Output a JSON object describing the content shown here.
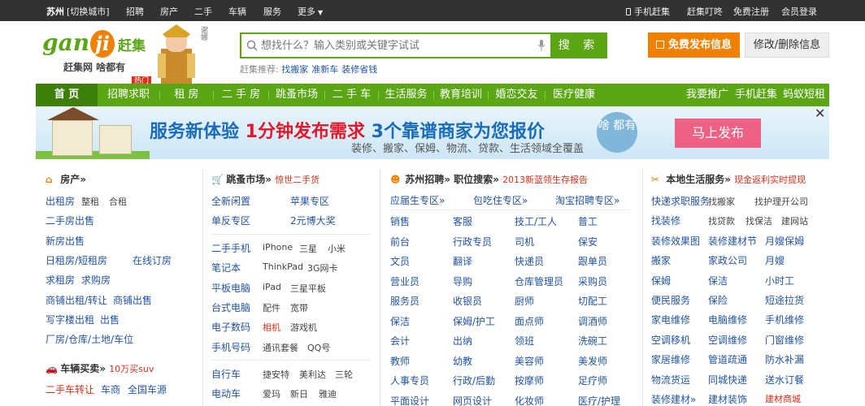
{
  "top": {
    "city": "苏州",
    "switch": "[切换城市]",
    "nav": [
      "招聘",
      "房产",
      "二手",
      "车辆",
      "服务",
      "更多"
    ],
    "mobile": "手机赶集",
    "ganji_ding": "赶集叮咚",
    "register": "免费注册",
    "login": "会员登录"
  },
  "logo": {
    "brand_left": "gan",
    "brand_mid": "ji",
    "brand_right": "赶集",
    "slogan": "赶集网 啥都有",
    "hot": "热门",
    "star": "谢娜"
  },
  "search": {
    "placeholder": "想找什么？输入类别或关键字试试",
    "button": "搜 索",
    "hot_label": "赶集推荐:",
    "hot": [
      "找搬家",
      "准新车",
      "装修省钱"
    ]
  },
  "buttons": {
    "post": "免费发布信息",
    "edit": "修改/删除信息"
  },
  "nav": {
    "items": [
      "首 页",
      "招聘求职",
      "租 房",
      "二 手 房",
      "跳蚤市场",
      "二 手 车",
      "生活服务",
      "教育培训",
      "婚恋交友",
      "医疗健康"
    ],
    "right": [
      "我要推广",
      "手机赶集",
      "蚂蚁短租"
    ]
  },
  "banner": {
    "headline_a": "服务新体验 ",
    "headline_b": "1分钟发布需求",
    "headline_c": " 3个靠谱商家为您报价",
    "sub": "装修、搬家、保姆、物流、贷款、生活领域全覆盖",
    "bubble": "啥 都有",
    "go": "马上发布",
    "close": "✕"
  },
  "col1": {
    "title": "房产»",
    "rows": [
      [
        "出租房",
        "整租",
        "合租"
      ],
      [
        "二手房出售"
      ],
      [
        "新房出售"
      ],
      [
        "日租房/短租房",
        "在线订房"
      ],
      [
        "求租房",
        "求购房"
      ],
      [
        "商铺出租/转让",
        "商铺出售"
      ],
      [
        "写字楼出租",
        "出售"
      ],
      [
        "厂房/仓库/土地/车位"
      ]
    ],
    "title2": "车辆买卖»",
    "sub2": "10万买suv",
    "rows2": [
      [
        "二手车转让",
        "车商",
        "全国车源"
      ]
    ]
  },
  "col2": {
    "title": "跳蚤市场»",
    "sub": "惊世二手货",
    "a": [
      [
        "全新闲置",
        "苹果专区"
      ],
      [
        "单反专区",
        "2元博大奖"
      ]
    ],
    "b": [
      [
        "二手手机",
        "iPhone",
        "三星",
        "小米"
      ],
      [
        "笔记本",
        "ThinkPad",
        "3G网卡"
      ],
      [
        "平板电脑",
        "iPad",
        "三星平板"
      ],
      [
        "台式电脑",
        "配件",
        "宽带"
      ],
      [
        "电子数码",
        "相机",
        "游戏机"
      ],
      [
        "手机号码",
        "通讯套餐",
        "QQ号"
      ]
    ],
    "c": [
      [
        "自行车",
        "捷安特",
        "美利达",
        "三轮"
      ],
      [
        "电动车",
        "爱玛",
        "新日",
        "雅迪"
      ]
    ]
  },
  "col3": {
    "title": "苏州招聘» 职位搜索»",
    "sub": "2013新蓝领生存报告",
    "top": [
      "应届生专区»",
      "包吃住专区»",
      "淘宝招聘专区»"
    ],
    "grid": [
      [
        "销售",
        "客服",
        "技工/工人",
        "普工"
      ],
      [
        "前台",
        "行政专员",
        "司机",
        "保安"
      ],
      [
        "文员",
        "翻译",
        "快递员",
        "跟单员"
      ],
      [
        "营业员",
        "导购",
        "仓库管理员",
        "采购员"
      ],
      [
        "服务员",
        "收银员",
        "厨师",
        "切配工"
      ],
      [
        "保洁",
        "保姆/护工",
        "面点师",
        "调酒师"
      ],
      [
        "会计",
        "出纳",
        "领班",
        "洗碗工"
      ],
      [
        "教师",
        "幼教",
        "美容师",
        "美发师"
      ],
      [
        "人事专员",
        "行政/后勤",
        "按摩师",
        "足疗师"
      ],
      [
        "平面设计",
        "网页设计",
        "化妆师",
        "医疗/护理"
      ]
    ]
  },
  "col4": {
    "title": "本地生活服务»",
    "sub": "现金返利实时提现",
    "rows": [
      [
        "快递求职服务",
        "找搬家",
        "找护理",
        "开公司"
      ],
      [
        "找装修",
        "找贷款",
        "找保洁",
        "建网站"
      ],
      [
        "装修效果图",
        "装修建材节",
        "月嫂保姆"
      ],
      [
        "搬家",
        "家政公司",
        "月嫂"
      ],
      [
        "保姆",
        "保洁",
        "小时工"
      ],
      [
        "便民服务",
        "保险",
        "短途拉货"
      ],
      [
        "家电维修",
        "电脑维修",
        "手机维修"
      ],
      [
        "空调移机",
        "空调维修",
        "门窗维修"
      ],
      [
        "家居维修",
        "管道疏通",
        "防水补漏"
      ],
      [
        "物流货运",
        "同城快递",
        "送水订餐"
      ],
      [
        "装修建材»",
        "建材装饰",
        "建材商城"
      ]
    ]
  }
}
